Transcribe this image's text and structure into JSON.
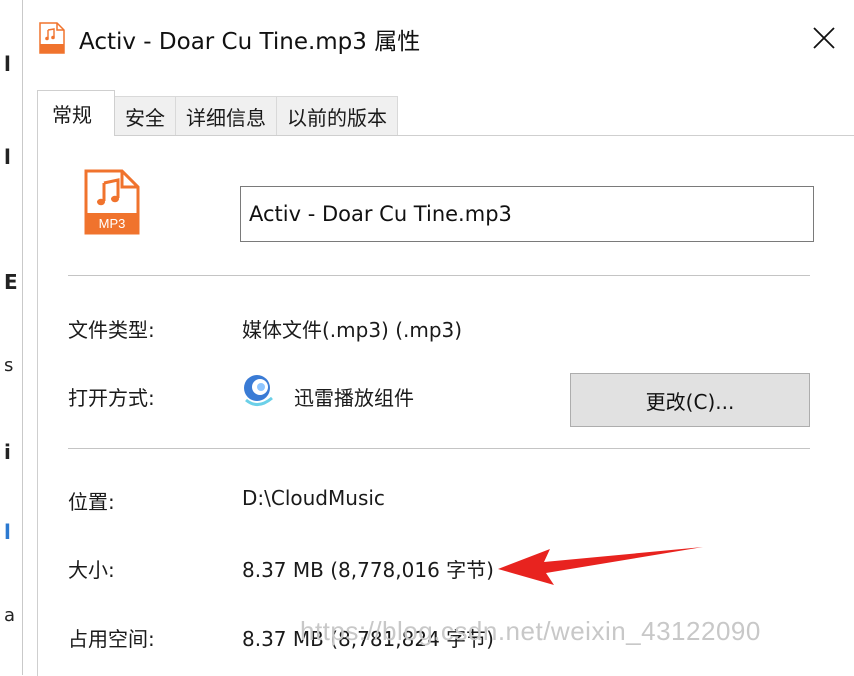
{
  "window": {
    "title": "Activ - Doar Cu Tine.mp3 属性",
    "title_icon": "mp3-file-icon",
    "close_icon": "close-icon"
  },
  "tabs": [
    {
      "label": "常规",
      "active": true
    },
    {
      "label": "安全",
      "active": false
    },
    {
      "label": "详细信息",
      "active": false
    },
    {
      "label": "以前的版本",
      "active": false
    }
  ],
  "general": {
    "file_icon_label": "MP3",
    "file_name": "Activ - Doar Cu Tine.mp3",
    "file_type_label": "文件类型:",
    "file_type_value": "媒体文件(.mp3) (.mp3)",
    "open_with_label": "打开方式:",
    "open_with_value": "迅雷播放组件",
    "change_button": "更改(C)...",
    "location_label": "位置:",
    "location_value": "D:\\CloudMusic",
    "size_label": "大小:",
    "size_value": "8.37 MB (8,778,016 字节)",
    "size_on_disk_label": "占用空间:",
    "size_on_disk_value": "8.37 MB (8,781,824 字节)"
  },
  "watermark": "https://blog.csdn.net/weixin_43122090",
  "background_glyphs": [
    "l",
    "l",
    "E",
    "s",
    "i",
    "l",
    "a"
  ],
  "colors": {
    "mp3_orange": "#f0732d",
    "arrow_red": "#e8231f",
    "button_bg": "#e1e1e1",
    "tab_inactive_bg": "#f0f0f0"
  }
}
